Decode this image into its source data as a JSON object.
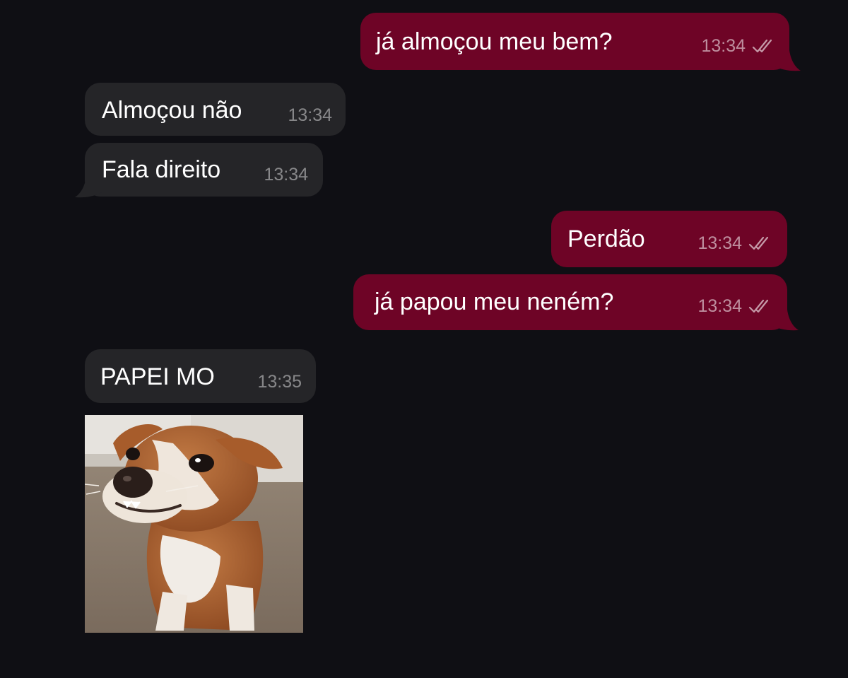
{
  "colors": {
    "background": "#0f0f14",
    "outgoing_bubble": "#6e0426",
    "incoming_bubble": "#252528",
    "text": "#ffffff"
  },
  "messages": [
    {
      "direction": "outgoing",
      "text": "já almoçou meu bem?",
      "time": "13:34",
      "status_icon": "double-check-icon"
    },
    {
      "direction": "incoming",
      "text": "Almoçou não",
      "time": "13:34"
    },
    {
      "direction": "incoming",
      "text": "Fala direito",
      "time": "13:34"
    },
    {
      "direction": "outgoing",
      "text": "Perdão",
      "time": "13:34",
      "status_icon": "double-check-icon"
    },
    {
      "direction": "outgoing",
      "text": "já papou meu neném?",
      "time": "13:34",
      "status_icon": "double-check-icon"
    },
    {
      "direction": "incoming",
      "text": "PAPEI MO",
      "time": "13:35"
    }
  ],
  "sticker": {
    "direction": "incoming",
    "icon": "dog-sticker"
  }
}
